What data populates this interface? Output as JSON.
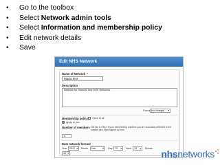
{
  "bullets": [
    {
      "prefix": "Go to the toolbox",
      "bold": "",
      "suffix": ""
    },
    {
      "prefix": "Select ",
      "bold": "Network admin tools",
      "suffix": ""
    },
    {
      "prefix": "Select ",
      "bold": "Information and membership policy",
      "suffix": ""
    },
    {
      "prefix": "Edit network details",
      "bold": "",
      "suffix": ""
    },
    {
      "prefix": "Save",
      "bold": "",
      "suffix": ""
    }
  ],
  "panel": {
    "title": "Edit NHS Network",
    "name_label": "Name of Network",
    "required_mark": "*",
    "name_value": "Maria test",
    "description_label": "Description",
    "description_value": "Network for Maria to test NHS Networks",
    "format_label": "Format",
    "format_value": "(no change)",
    "membership_label": "Membership policy",
    "membership_option_open": "Open to all",
    "membership_option_apply": "Apply to join",
    "members_label": "Number of members",
    "members_note": "ON this is ONLY if your membership numbers you are accurately reflected in the number who have signed up here",
    "members_value": "0",
    "date_label": "Date network formed",
    "year_label": "Year",
    "year_value": "2012",
    "month_label": "Month",
    "month_value": "Feb",
    "day_label": "Day",
    "day_value": "13",
    "hour_label": "Hour",
    "hour_value": "15",
    "minute_label": "Minute",
    "minute_value": "49"
  },
  "logo": {
    "part1": "nhs",
    "part2": "networks"
  },
  "colors": {
    "header_blue": "#2f6fb4",
    "logo_blue": "#2f6fb4",
    "required_red": "#dd0000"
  }
}
